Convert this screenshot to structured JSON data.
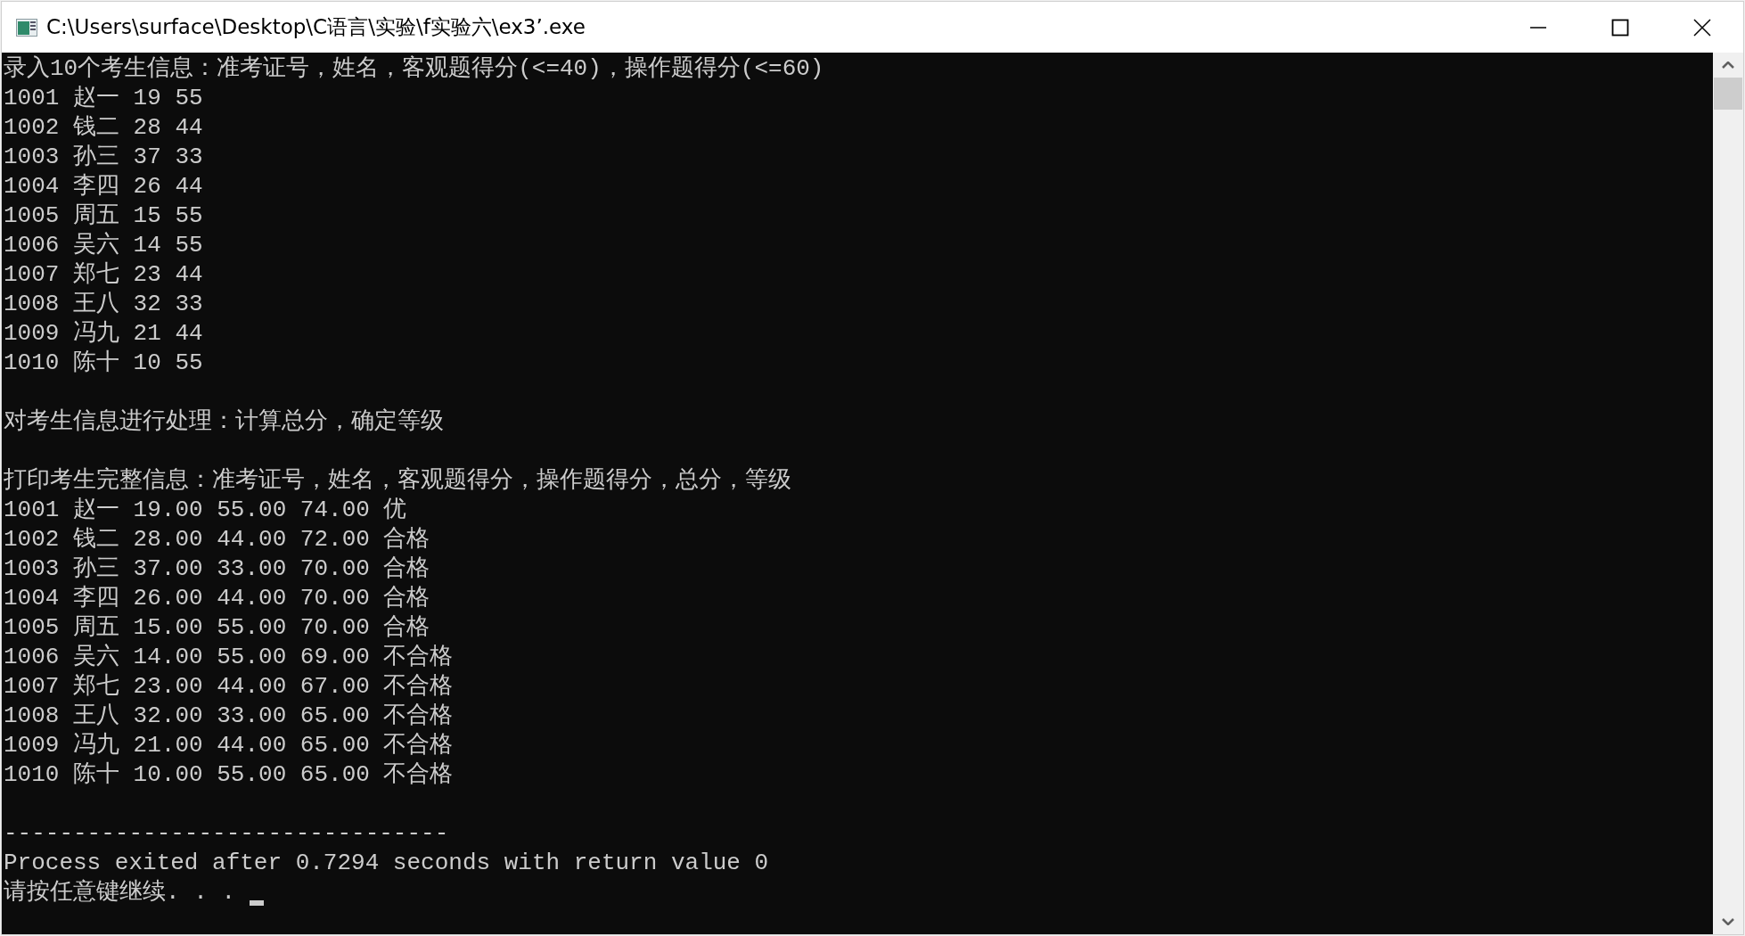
{
  "window": {
    "title": "C:\\Users\\surface\\Desktop\\C语言\\实验\\f实验六\\ex3’.exe"
  },
  "console": {
    "lines": [
      {
        "kind": "text",
        "text": "录入10个考生信息：准考证号，姓名，客观题得分(<=40)，操作题得分(<=60)"
      },
      {
        "kind": "text",
        "text": "1001 赵一 19 55"
      },
      {
        "kind": "text",
        "text": "1002 钱二 28 44"
      },
      {
        "kind": "text",
        "text": "1003 孙三 37 33"
      },
      {
        "kind": "text",
        "text": "1004 李四 26 44"
      },
      {
        "kind": "text",
        "text": "1005 周五 15 55"
      },
      {
        "kind": "text",
        "text": "1006 吴六 14 55"
      },
      {
        "kind": "text",
        "text": "1007 郑七 23 44"
      },
      {
        "kind": "text",
        "text": "1008 王八 32 33"
      },
      {
        "kind": "text",
        "text": "1009 冯九 21 44"
      },
      {
        "kind": "text",
        "text": "1010 陈十 10 55"
      },
      {
        "kind": "blank"
      },
      {
        "kind": "text",
        "text": "对考生信息进行处理：计算总分，确定等级"
      },
      {
        "kind": "blank"
      },
      {
        "kind": "text",
        "text": "打印考生完整信息：准考证号，姓名，客观题得分，操作题得分，总分，等级"
      },
      {
        "kind": "text",
        "text": "1001 赵一 19.00 55.00 74.00 优"
      },
      {
        "kind": "text",
        "text": "1002 钱二 28.00 44.00 72.00 合格"
      },
      {
        "kind": "text",
        "text": "1003 孙三 37.00 33.00 70.00 合格"
      },
      {
        "kind": "text",
        "text": "1004 李四 26.00 44.00 70.00 合格"
      },
      {
        "kind": "text",
        "text": "1005 周五 15.00 55.00 70.00 合格"
      },
      {
        "kind": "text",
        "text": "1006 吴六 14.00 55.00 69.00 不合格"
      },
      {
        "kind": "text",
        "text": "1007 郑七 23.00 44.00 67.00 不合格"
      },
      {
        "kind": "text",
        "text": "1008 王八 32.00 33.00 65.00 不合格"
      },
      {
        "kind": "text",
        "text": "1009 冯九 21.00 44.00 65.00 不合格"
      },
      {
        "kind": "text",
        "text": "1010 陈十 10.00 55.00 65.00 不合格"
      },
      {
        "kind": "blank"
      },
      {
        "kind": "text",
        "text": "--------------------------------"
      },
      {
        "kind": "text",
        "text": "Process exited after 0.7294 seconds with return value 0"
      },
      {
        "kind": "prompt",
        "text": "请按任意键继续. . . ",
        "cursor": true
      }
    ]
  }
}
